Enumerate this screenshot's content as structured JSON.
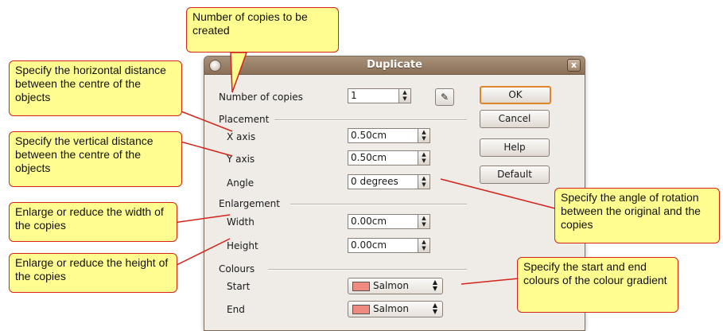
{
  "dialog": {
    "title": "Duplicate",
    "close_label": "x",
    "number_of_copies": {
      "label": "Number of copies",
      "value": "1"
    },
    "placement": {
      "heading": "Placement",
      "x_axis": {
        "label": "X axis",
        "value": "0.50cm"
      },
      "y_axis": {
        "label": "Y axis",
        "value": "0.50cm"
      },
      "angle": {
        "label": "Angle",
        "value": "0 degrees"
      }
    },
    "enlargement": {
      "heading": "Enlargement",
      "width": {
        "label": "Width",
        "value": "0.00cm"
      },
      "height": {
        "label": "Height",
        "value": "0.00cm"
      }
    },
    "colours": {
      "heading": "Colours",
      "start": {
        "label": "Start",
        "value": "Salmon",
        "swatch": "#ef8a80"
      },
      "end": {
        "label": "End",
        "value": "Salmon",
        "swatch": "#ef8a80"
      }
    },
    "buttons": {
      "ok": "OK",
      "cancel": "Cancel",
      "help": "Help",
      "default": "Default"
    }
  },
  "callouts": {
    "copies": "Number of copies to be created",
    "horizontal": "Specify the horizontal distance between the centre of the objects",
    "vertical": "Specify the vertical distance between the centre of the objects",
    "width": "Enlarge or reduce the width of the copies",
    "height": "Enlarge or reduce the height of the copies",
    "angle": "Specify the angle of rotation between the original and the copies",
    "colours": "Specify the start and end colours of the colour gradient"
  },
  "colors": {
    "callout_fill": "#fffc90",
    "callout_border": "#d4241b",
    "title_bar": "#977c63"
  }
}
